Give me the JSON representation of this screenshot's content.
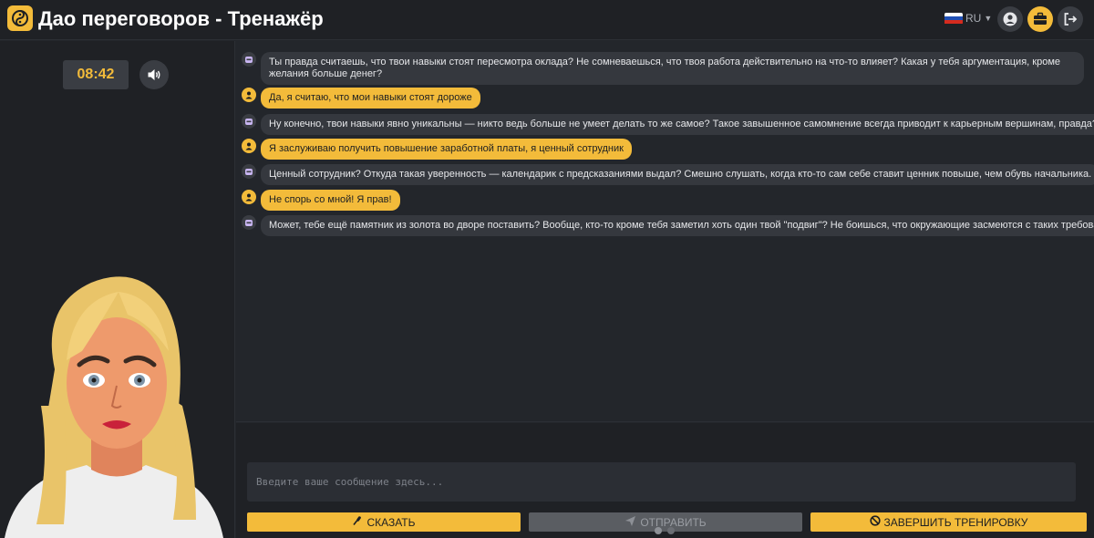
{
  "header": {
    "title": "Дао переговоров - Тренажёр",
    "logo_icon": "yin-yang-logo-icon",
    "language": "RU",
    "language_icon": "russian-flag-icon",
    "buttons": [
      "profile-icon",
      "briefcase-icon",
      "logout-icon"
    ]
  },
  "left_panel": {
    "timer": "08:42",
    "sound_icon": "speaker-icon"
  },
  "chat": {
    "messages": [
      {
        "role": "bot",
        "text": "Ты правда считаешь, что твои навыки стоят пересмотра оклада? Не сомневаешься, что твоя работа действительно на что-то влияет? Какая у тебя аргументация, кроме желания больше денег?"
      },
      {
        "role": "user",
        "text": "Да, я считаю, что мои навыки стоят дороже"
      },
      {
        "role": "bot",
        "text": "Ну конечно, твои навыки явно уникальны — никто ведь больше не умеет делать то же самое? Такое завышенное самомнение всегда приводит к карьерным вершинам, правда?"
      },
      {
        "role": "user",
        "text": "Я заслуживаю получить повышение заработной платы, я ценный сотрудник"
      },
      {
        "role": "bot",
        "text": "Ценный сотрудник? Откуда такая уверенность — календарик с предсказаниями выдал? Смешно слушать, когда кто-то сам себе ставит ценник повыше, чем обувь начальника."
      },
      {
        "role": "user",
        "text": "Не спорь со мной! Я прав!"
      },
      {
        "role": "bot",
        "text": "Может, тебе ещё памятник из золота во дворе поставить? Вообще, кто-то кроме тебя заметил хоть один твой \"подвиг\"? Не боишься, что окружающие засмеются с таких требований?"
      }
    ]
  },
  "composer": {
    "placeholder": "Введите ваше сообщение здесь...",
    "say_label": "СКАЗАТЬ",
    "send_label": "ОТПРАВИТЬ",
    "finish_label": "ЗАВЕРШИТЬ ТРЕНИРОВКУ"
  },
  "colors": {
    "accent": "#f3bb3a",
    "background": "#23262b",
    "panel": "#1f2125",
    "bubble_bot": "#35383e"
  }
}
